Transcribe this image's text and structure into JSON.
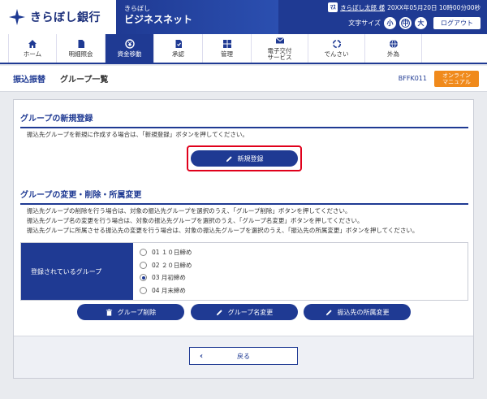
{
  "header": {
    "bank_name": "きらぼし銀行",
    "service_small": "きらぼし",
    "service_name": "ビジネスネット",
    "user_badge": "ﾏｽ",
    "user_name": "きらぼし太郎 様",
    "last_login": "20XX年05月20日 10時00分00秒",
    "font_size_label": "文字サイズ",
    "font_small": "小",
    "font_medium": "中",
    "font_large": "大",
    "logout_label": "ログアウト"
  },
  "nav": {
    "items": [
      {
        "label": "ホーム",
        "icon": "home-icon"
      },
      {
        "label": "明細照会",
        "icon": "document-icon"
      },
      {
        "label": "資金移動",
        "icon": "yen-icon"
      },
      {
        "label": "承認",
        "icon": "approval-icon"
      },
      {
        "label": "管理",
        "icon": "grid-icon"
      },
      {
        "label": "電子交付\nサービス",
        "icon": "mail-icon"
      },
      {
        "label": "でんさい",
        "icon": "cycle-icon"
      },
      {
        "label": "外為",
        "icon": "globe-icon"
      }
    ]
  },
  "page": {
    "category": "振込振替",
    "title": "グループ一覧",
    "screen_id": "BFFK011",
    "manual_label": "オンライン\nマニュアル"
  },
  "new_section": {
    "title": "グループの新規登録",
    "description": "振込先グループを新規に作成する場合は、「新規登録」ボタンを押してください。",
    "button_label": "新規登録"
  },
  "edit_section": {
    "title": "グループの変更・削除・所属変更",
    "descriptions": [
      "振込先グループの削除を行う場合は、対象の振込先グループを選択のうえ、「グループ削除」ボタンを押してください。",
      "振込先グループ名の変更を行う場合は、対象の振込先グループを選択のうえ、「グループ名変更」ボタンを押してください。",
      "振込先グループに所属させる振込先の変更を行う場合は、対象の振込先グループを選択のうえ、「振込先の所属変更」ボタンを押してください。"
    ],
    "table_header": "登録されているグループ",
    "groups": [
      {
        "label": "01 １０日締め",
        "selected": false
      },
      {
        "label": "02 ２０日締め",
        "selected": false
      },
      {
        "label": "03 月初締め",
        "selected": true
      },
      {
        "label": "04 月末締め",
        "selected": false
      }
    ],
    "delete_label": "グループ削除",
    "rename_label": "グループ名変更",
    "assign_label": "振込先の所属変更"
  },
  "footer": {
    "back_label": "戻る"
  }
}
